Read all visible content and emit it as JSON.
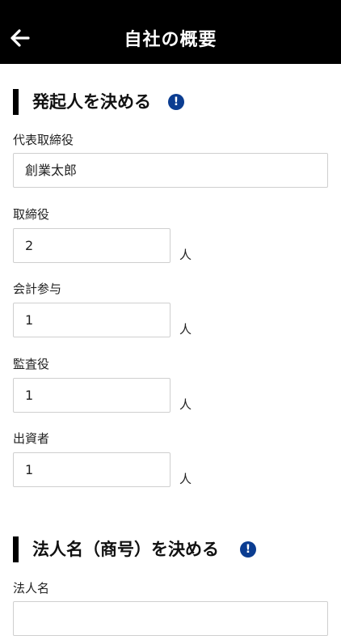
{
  "header": {
    "title": "自社の概要"
  },
  "section1": {
    "title": "発起人を決める",
    "info_icon": "!",
    "fields": {
      "rep_director": {
        "label": "代表取締役",
        "value": "創業太郎"
      },
      "directors": {
        "label": "取締役",
        "value": "2",
        "unit": "人"
      },
      "accounting_advisor": {
        "label": "会計参与",
        "value": "1",
        "unit": "人"
      },
      "auditor": {
        "label": "監査役",
        "value": "1",
        "unit": "人"
      },
      "investors": {
        "label": "出資者",
        "value": "1",
        "unit": "人"
      }
    }
  },
  "section2": {
    "title": "法人名（商号）を決める",
    "info_icon": "!",
    "fields": {
      "corp_name": {
        "label": "法人名",
        "value": ""
      }
    }
  }
}
